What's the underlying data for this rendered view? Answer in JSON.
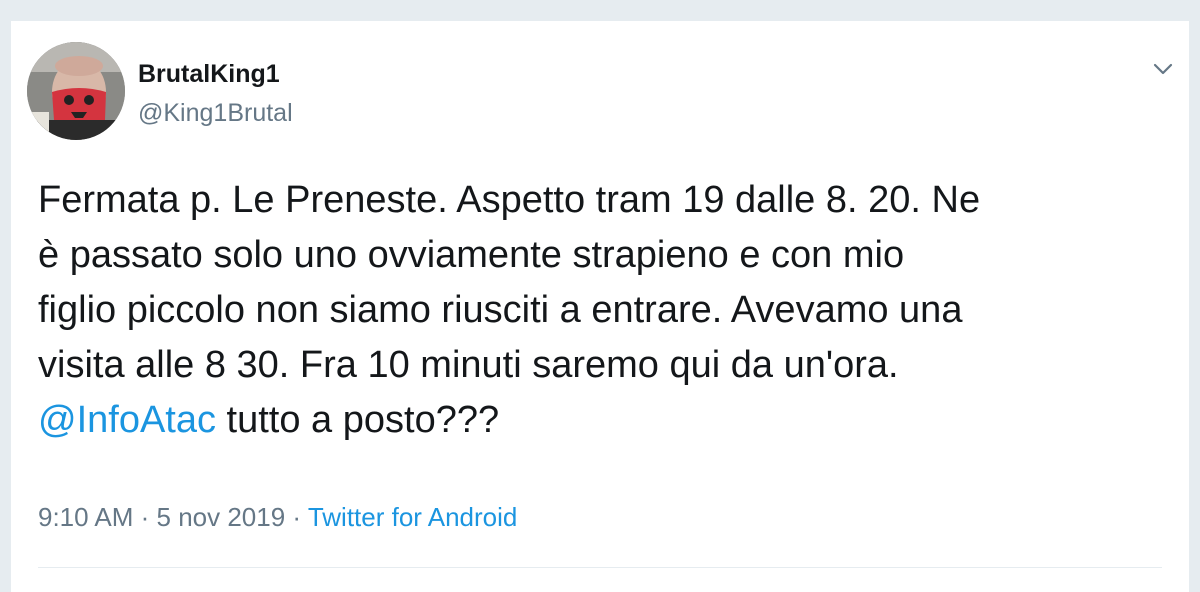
{
  "author": {
    "display_name": "BrutalKing1",
    "handle": "@King1Brutal"
  },
  "tweet": {
    "text_lines": [
      "Fermata p. Le Preneste. Aspetto  tram 19 dalle 8. 20. Ne",
      "è passato solo uno ovviamente strapieno e con mio",
      "figlio piccolo non siamo riusciti a entrare. Avevamo una",
      "visita alle 8 30. Fra 10 minuti saremo qui da un'ora."
    ],
    "mention": "@InfoAtac",
    "text_after_mention": " tutto a posto???"
  },
  "meta": {
    "time": "9:10 AM",
    "separator": " · ",
    "date": "5 nov 2019",
    "separator2": " · ",
    "source": "Twitter for Android"
  },
  "icons": {
    "menu": "chevron-down-icon",
    "avatar": "avatar"
  },
  "colors": {
    "link": "#1b95e0",
    "muted": "#657786",
    "text": "#14171a"
  }
}
